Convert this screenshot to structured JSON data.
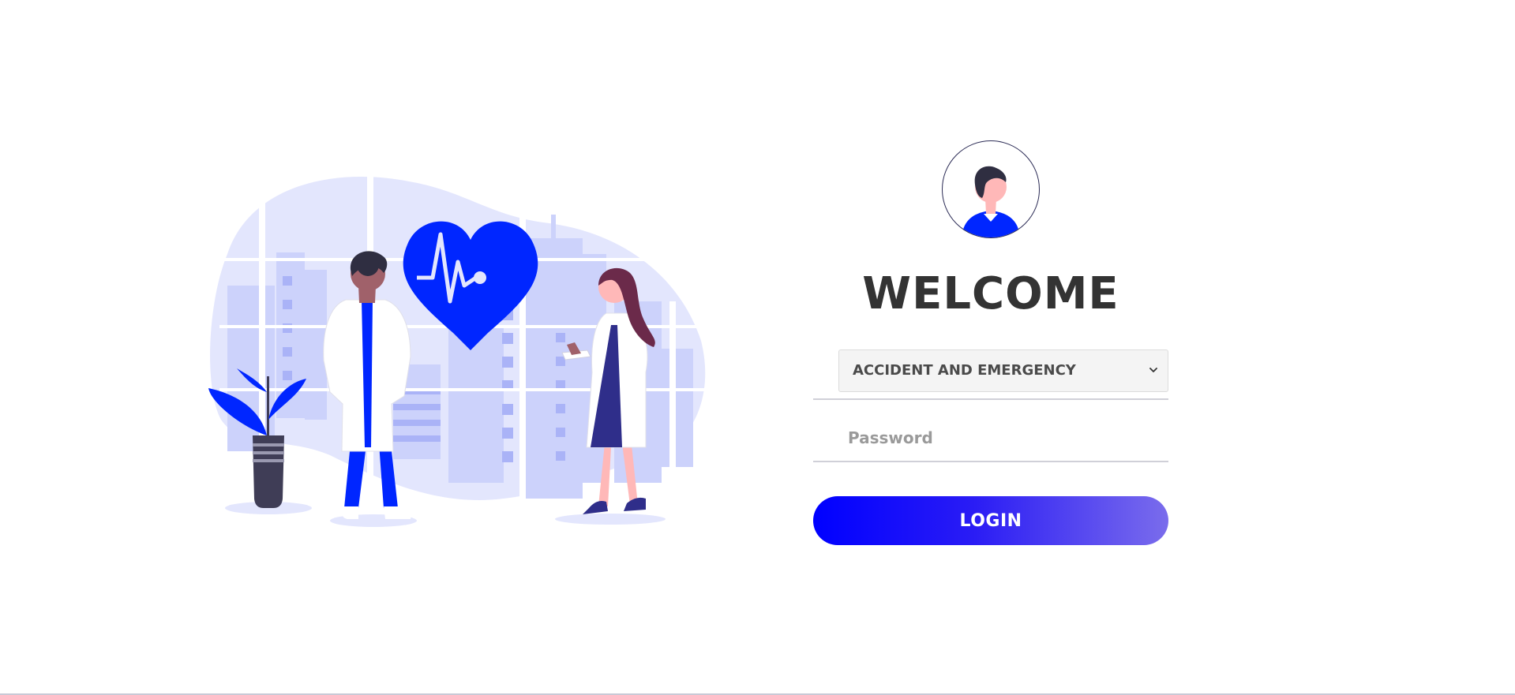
{
  "login": {
    "heading": "WELCOME",
    "department_select": {
      "selected": "ACCIDENT AND EMERGENCY"
    },
    "password": {
      "placeholder": "Password",
      "value": ""
    },
    "login_button_label": "LOGIN"
  },
  "colors": {
    "accent": "#0026ff",
    "button_gradient_start": "#0000ff",
    "button_gradient_end": "#7a6cec",
    "heading": "#333333",
    "illustration_bg": "#e3e6fd"
  },
  "icons": {
    "avatar": "user-avatar-icon",
    "select_arrow": "chevron-down-icon",
    "heart": "heartbeat-heart-icon"
  }
}
